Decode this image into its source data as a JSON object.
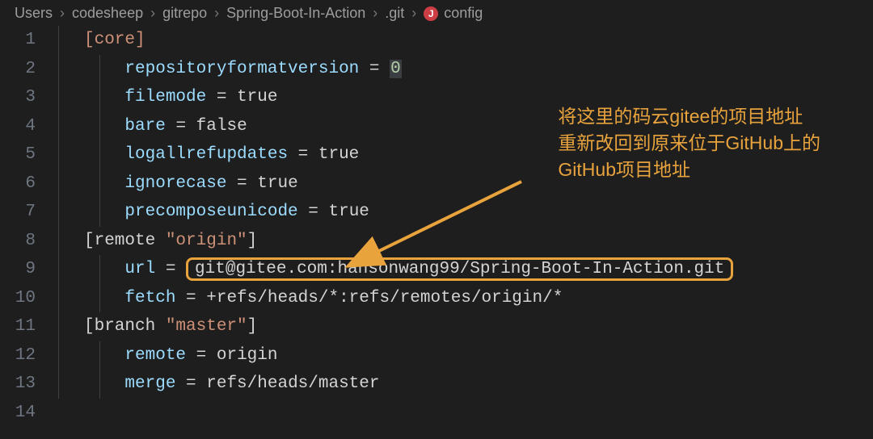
{
  "breadcrumb": {
    "items": [
      "Users",
      "codesheep",
      "gitrepo",
      "Spring-Boot-In-Action",
      ".git",
      "config"
    ],
    "fileIconLetter": "J"
  },
  "lineNumbers": [
    "1",
    "2",
    "3",
    "4",
    "5",
    "6",
    "7",
    "8",
    "9",
    "10",
    "11",
    "12",
    "13",
    "14"
  ],
  "code": {
    "l1": {
      "section": "[core]"
    },
    "l2": {
      "key": "repositoryformatversion",
      "eq": " = ",
      "val": "0"
    },
    "l3": {
      "key": "filemode",
      "eq": " = ",
      "val": "true"
    },
    "l4": {
      "key": "bare",
      "eq": " = ",
      "val": "false"
    },
    "l5": {
      "key": "logallrefupdates",
      "eq": " = ",
      "val": "true"
    },
    "l6": {
      "key": "ignorecase",
      "eq": " = ",
      "val": "true"
    },
    "l7": {
      "key": "precomposeunicode",
      "eq": " = ",
      "val": "true"
    },
    "l8": {
      "pre": "[remote ",
      "str": "\"origin\"",
      "post": "]"
    },
    "l9": {
      "key": "url",
      "eq": " = ",
      "val": "git@gitee.com:hansonwang99/Spring-Boot-In-Action.git"
    },
    "l10": {
      "key": "fetch",
      "eq": " = ",
      "val": "+refs/heads/*:refs/remotes/origin/*"
    },
    "l11": {
      "pre": "[branch ",
      "str": "\"master\"",
      "post": "]"
    },
    "l12": {
      "key": "remote",
      "eq": " = ",
      "val": "origin"
    },
    "l13": {
      "key": "merge",
      "eq": " = ",
      "val": "refs/heads/master"
    }
  },
  "annotation": {
    "line1": "将这里的码云gitee的项目地址",
    "line2": "重新改回到原来位于GitHub上的",
    "line3": "GitHub项目地址"
  }
}
